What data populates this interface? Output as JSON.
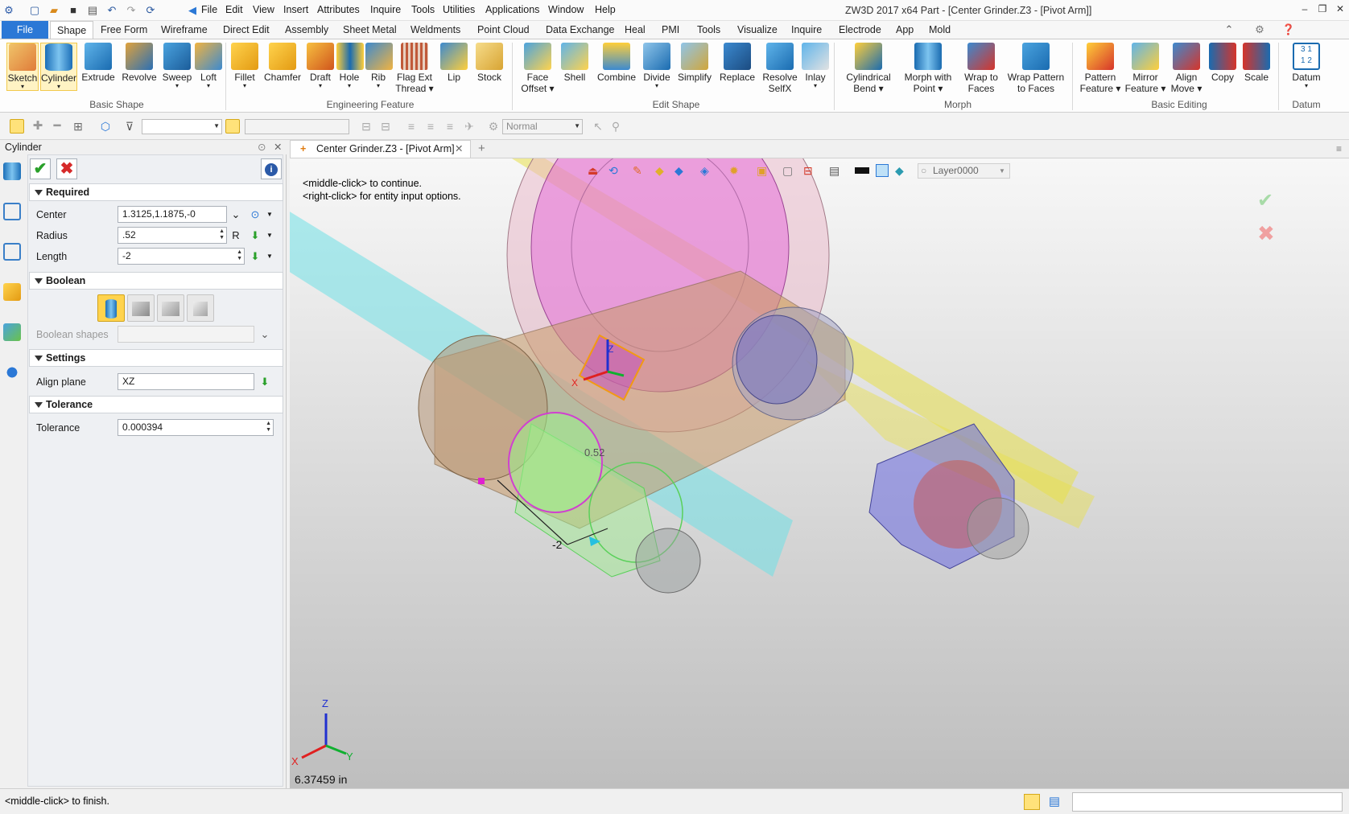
{
  "window": {
    "title": "ZW3D 2017  x64        Part - [Center Grinder.Z3 - [Pivot Arm]]"
  },
  "menu": [
    "File",
    "Edit",
    "View",
    "Insert",
    "Attributes",
    "Inquire",
    "Tools",
    "Utilities",
    "Applications",
    "Window",
    "Help"
  ],
  "ribbon_tabs": [
    "File",
    "Shape",
    "Free Form",
    "Wireframe",
    "Direct Edit",
    "Assembly",
    "Sheet Metal",
    "Weldments",
    "Point Cloud",
    "Data Exchange",
    "Heal",
    "PMI",
    "Tools",
    "Visualize",
    "Inquire",
    "Electrode",
    "App",
    "Mold"
  ],
  "ribbon": {
    "basic_shape": {
      "group": "Basic Shape",
      "buttons": [
        "Sketch",
        "Cylinder",
        "Extrude",
        "Revolve",
        "Sweep",
        "Loft"
      ]
    },
    "engineering": {
      "group": "Engineering Feature",
      "buttons": [
        "Fillet",
        "Chamfer",
        "Draft",
        "Hole",
        "Rib",
        "Flag Ext",
        "Thread",
        "Lip",
        "Stock"
      ]
    },
    "edit_shape": {
      "group": "Edit Shape",
      "buttons": [
        "Face",
        "Offset",
        "Shell",
        "Combine",
        "Divide",
        "Simplify",
        "Replace",
        "Resolve",
        "SelfX",
        "Inlay"
      ]
    },
    "morph": {
      "group": "Morph",
      "buttons": [
        "Cylindrical",
        "Bend",
        "Morph with",
        "Point",
        "Wrap to",
        "Faces",
        "Wrap Pattern",
        "to Faces"
      ]
    },
    "basic_editing": {
      "group": "Basic Editing",
      "buttons": [
        "Pattern",
        "Feature",
        "Mirror",
        "Feature",
        "Align",
        "Move",
        "Copy",
        "Scale"
      ]
    },
    "datum": {
      "group": "Datum",
      "buttons": [
        "Datum"
      ]
    }
  },
  "toolbar": {
    "render_mode": "Normal"
  },
  "panel": {
    "title": "Cylinder",
    "sections": {
      "required": "Required",
      "boolean": "Boolean",
      "settings": "Settings",
      "tolerance": "Tolerance"
    },
    "fields": {
      "center_label": "Center",
      "center_value": "1.3125,1.1875,-0",
      "radius_label": "Radius",
      "radius_value": ".52",
      "radius_suffix": "R",
      "length_label": "Length",
      "length_value": "-2",
      "boolean_shapes_label": "Boolean shapes",
      "align_plane_label": "Align plane",
      "align_plane_value": "XZ",
      "tolerance_label": "Tolerance",
      "tolerance_value": "0.000394"
    }
  },
  "document_tab": "Center Grinder.Z3 - [Pivot Arm]",
  "viewport": {
    "hint1": "<middle-click> to continue.",
    "hint2": "<right-click> for entity input options.",
    "layer": "Layer0000",
    "radius_dim": "0.52",
    "length_dim": "-2",
    "distance": "6.37459 in",
    "axis_x": "X",
    "axis_y": "Y",
    "axis_z": "Z"
  },
  "status": {
    "message": "<middle-click> to finish."
  }
}
